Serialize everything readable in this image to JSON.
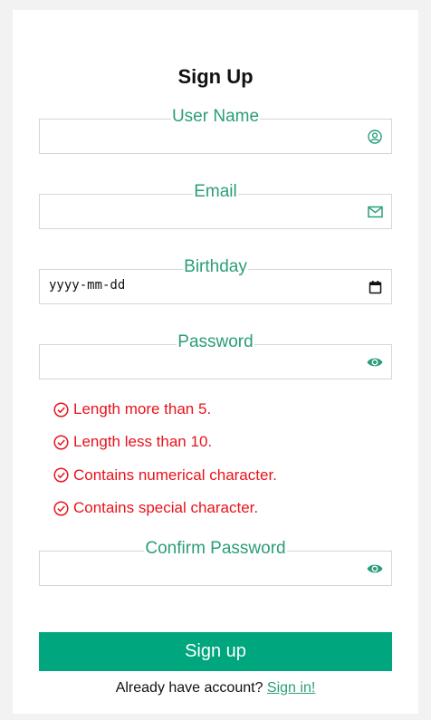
{
  "form": {
    "title": "Sign Up",
    "fields": {
      "username": {
        "label": "User Name",
        "value": "",
        "icon": "user-circle-icon"
      },
      "email": {
        "label": "Email",
        "value": "",
        "icon": "mail-icon"
      },
      "birthday": {
        "label": "Birthday",
        "placeholder": "yyyy-mm-dd",
        "icon": "calendar-icon"
      },
      "password": {
        "label": "Password",
        "value": "",
        "icon": "eye-icon"
      },
      "confirm_password": {
        "label": "Confirm Password",
        "value": "",
        "icon": "eye-icon"
      }
    },
    "rules": [
      {
        "text": "Length more than 5."
      },
      {
        "text": "Length less than 10."
      },
      {
        "text": "Contains numerical character."
      },
      {
        "text": "Contains special character."
      }
    ],
    "submit_label": "Sign up",
    "footer_text": "Already have account?",
    "signin_link": "Sign in!"
  },
  "colors": {
    "accent": "#2a9d7a",
    "button": "#00a67e",
    "error": "#e8131b",
    "border": "#d6d6d6",
    "background": "#f2f2f2"
  }
}
